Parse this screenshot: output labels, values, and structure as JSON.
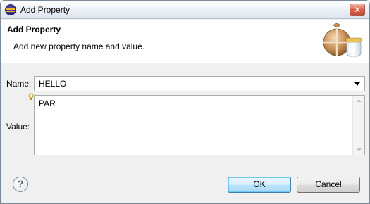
{
  "window": {
    "title": "Add Property"
  },
  "banner": {
    "title": "Add Property",
    "message": "Add new property name and value.",
    "graphic_icon": "package-jar-icon"
  },
  "form": {
    "name_label": "Name:",
    "name_value": "HELLO",
    "value_label": "Value:",
    "value_text": "PAR",
    "hint_icon": "lightbulb-icon"
  },
  "buttons": {
    "ok_label": "OK",
    "cancel_label": "Cancel",
    "help_glyph": "?"
  },
  "colors": {
    "close_button": "#c34a33",
    "default_button_border": "#3c7fb1",
    "banner_background": "#ffffff",
    "dialog_background": "#f0f0f0"
  }
}
